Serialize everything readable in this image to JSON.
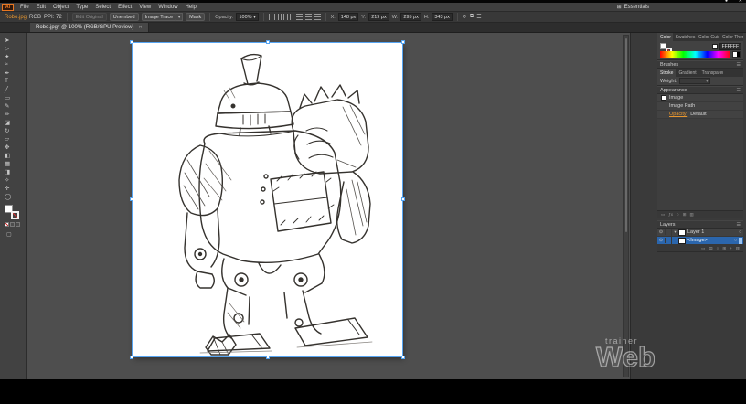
{
  "video_overlay": {
    "dot": "●",
    "close": "✕"
  },
  "menu_bar": {
    "logo": "Ai",
    "items": [
      "File",
      "Edit",
      "Object",
      "Type",
      "Select",
      "Effect",
      "View",
      "Window",
      "Help"
    ],
    "workspace": "Essentials"
  },
  "control_bar": {
    "file_link": "Robo.jpg",
    "color_mode": "RGB",
    "ppi": "PPI: 72",
    "edit_original": "Edit Original",
    "unembed": "Unembed",
    "image_trace": "Image Trace",
    "mask": "Mask",
    "opacity_label": "Opacity:",
    "opacity_value": "100%",
    "x_label": "X:",
    "x_value": "148 px",
    "y_label": "Y:",
    "y_value": "219 px",
    "w_label": "W:",
    "w_value": "295 px",
    "h_label": "H:",
    "h_value": "343 px"
  },
  "document_tab": {
    "title": "Robo.jpg* @ 100% (RGB/GPU Preview)"
  },
  "toolbar": {
    "tools": [
      {
        "name": "selection",
        "glyph": "➤"
      },
      {
        "name": "direct-selection",
        "glyph": "▷"
      },
      {
        "name": "magic-wand",
        "glyph": "✦"
      },
      {
        "name": "lasso",
        "glyph": "≈"
      },
      {
        "name": "pen",
        "glyph": "✒"
      },
      {
        "name": "type",
        "glyph": "T"
      },
      {
        "name": "line-segment",
        "glyph": "╱"
      },
      {
        "name": "rectangle",
        "glyph": "▭"
      },
      {
        "name": "paintbrush",
        "glyph": "✎"
      },
      {
        "name": "pencil",
        "glyph": "✏"
      },
      {
        "name": "eraser",
        "glyph": "◪"
      },
      {
        "name": "rotate",
        "glyph": "↻"
      },
      {
        "name": "scale",
        "glyph": "▱"
      },
      {
        "name": "width",
        "glyph": "✥"
      },
      {
        "name": "shape-builder",
        "glyph": "◧"
      },
      {
        "name": "mesh",
        "glyph": "▦"
      },
      {
        "name": "gradient",
        "glyph": "◨"
      },
      {
        "name": "eyedropper",
        "glyph": "✧"
      },
      {
        "name": "hand",
        "glyph": "✛"
      },
      {
        "name": "zoom",
        "glyph": "◯"
      }
    ]
  },
  "panels": {
    "color": {
      "tabs": [
        "Color",
        "Swatches",
        "Color Guide",
        "Color Themes"
      ],
      "hex": "FFFFFF"
    },
    "brushes": {
      "title": "Brushes"
    },
    "stroke": {
      "tabs": [
        "Stroke",
        "Gradient",
        "Transparency"
      ],
      "weight_label": "Weight:"
    },
    "appearance": {
      "title": "Appearance",
      "rows": [
        {
          "label": "Image"
        },
        {
          "label": "Image Path"
        },
        {
          "prefix": "Opacity:",
          "label": "Default"
        }
      ],
      "footer_icons": [
        "▭",
        "ƒx",
        "○",
        "⊞",
        "▥"
      ]
    },
    "layers": {
      "title": "Layers",
      "layer": "Layer 1",
      "sublayer": "<Image>",
      "footer_icons": [
        "▭",
        "▤",
        "○",
        "⊞",
        "+",
        "▥"
      ]
    }
  },
  "watermark": {
    "small": "trainer",
    "big": "Web"
  },
  "icons": {
    "record_dot": "●",
    "close": "✕",
    "dropdown": "▾",
    "caret_down": "▾",
    "eye": "⊙",
    "target": "○",
    "panel_menu": "☰",
    "collapse": "»",
    "workspace_grid": "⊞",
    "rotate": "⟳",
    "link": "⧉"
  },
  "colors": {
    "accent_orange": "#e8962e",
    "selection_blue": "#57a5f2",
    "layer_selected_bg": "#2b66ad",
    "canvas_gray": "#4e4e4e",
    "ui_dark": "#3a3a3a"
  }
}
